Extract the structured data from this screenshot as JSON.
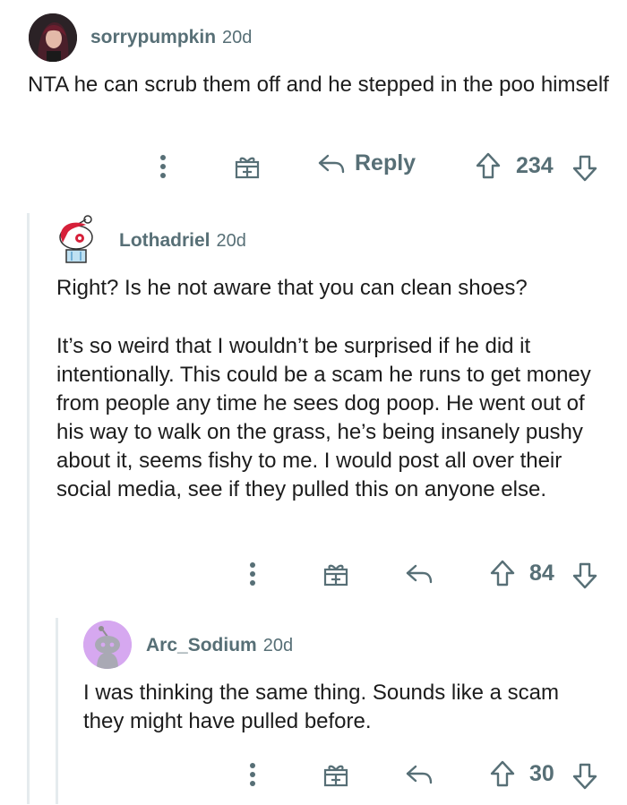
{
  "comments": [
    {
      "username": "sorrypumpkin",
      "age": "20d",
      "body": [
        "NTA he can scrub them off and he stepped in the poo himself"
      ],
      "reply_label": "Reply",
      "score": "234",
      "avatar_icon": "user-photo-avatar",
      "colors": {
        "avatar_bg": "#3a2f33"
      }
    },
    {
      "username": "Lothadriel",
      "age": "20d",
      "body": [
        "Right? Is he not aware that you can clean shoes?",
        "It’s so weird that I wouldn’t be surprised if he did it intentionally. This could be a scam he runs to get money from people any time he sees dog poop. He went out of his way to walk on the grass, he’s being insanely pushy about it, seems fishy to me. I would post all over their social media, see if they pulled this on anyone else."
      ],
      "score": "84",
      "avatar_icon": "snoo-red-hair-avatar",
      "colors": {
        "avatar_bg": "#f2f4f5"
      }
    },
    {
      "username": "Arc_Sodium",
      "age": "20d",
      "body": [
        "I was thinking the same thing.  Sounds like a scam they might have pulled before."
      ],
      "score": "30",
      "avatar_icon": "snoo-purple-avatar",
      "colors": {
        "avatar_bg": "#d6a8f0"
      }
    }
  ],
  "icons": {
    "more": "more-options-icon",
    "award": "award-icon",
    "reply": "reply-arrow-icon",
    "upvote": "upvote-icon",
    "downvote": "downvote-icon"
  },
  "colors": {
    "meta_text": "#576f76",
    "body_text": "#1c1c1c",
    "thread_line": "#e5ebee"
  }
}
